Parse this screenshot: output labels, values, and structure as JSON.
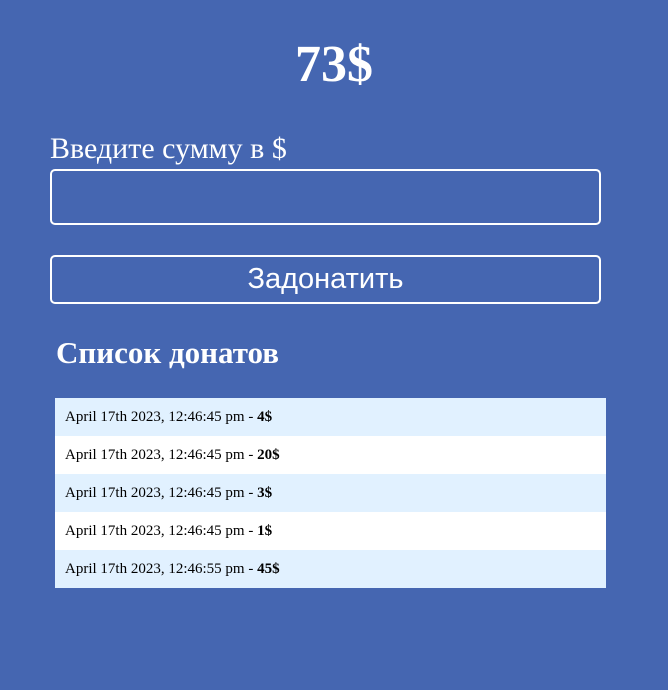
{
  "total": "73$",
  "form": {
    "label": "Введите сумму в $",
    "input_value": "",
    "button_label": "Задонатить"
  },
  "list": {
    "title": "Список донатов",
    "separator": " - ",
    "items": [
      {
        "timestamp": "April 17th 2023, 12:46:45 pm",
        "amount": "4$"
      },
      {
        "timestamp": "April 17th 2023, 12:46:45 pm",
        "amount": "20$"
      },
      {
        "timestamp": "April 17th 2023, 12:46:45 pm",
        "amount": "3$"
      },
      {
        "timestamp": "April 17th 2023, 12:46:45 pm",
        "amount": "1$"
      },
      {
        "timestamp": "April 17th 2023, 12:46:55 pm",
        "amount": "45$"
      }
    ]
  },
  "colors": {
    "background": "#4566b1",
    "row_alt": "#e1f1ff",
    "row": "#ffffff",
    "foreground": "#ffffff"
  }
}
